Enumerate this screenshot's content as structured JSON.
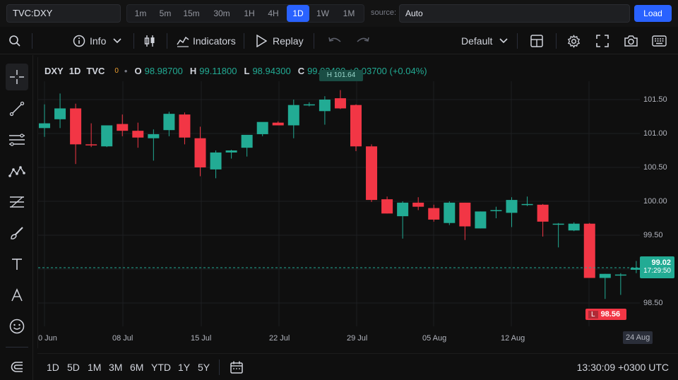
{
  "topbar": {
    "symbol": "TVC:DXY",
    "timeframes": [
      "1m",
      "5m",
      "15m",
      "30m",
      "1H",
      "4H",
      "1D",
      "1W",
      "1M"
    ],
    "active_timeframe": "1D",
    "source_label": "source:",
    "source_value": "Auto",
    "load_label": "Load"
  },
  "toolbar": {
    "info_label": "Info",
    "indicators_label": "Indicators",
    "replay_label": "Replay",
    "layout_label": "Default"
  },
  "legend": {
    "symbol": "DXY",
    "interval": "1D",
    "exchange": "TVC",
    "zero": "0",
    "open_key": "O",
    "open": "98.98700",
    "high_key": "H",
    "high": "99.11800",
    "low_key": "L",
    "low": "98.94300",
    "close_key": "C",
    "close": "99.02400",
    "change": "+0.03700 (+0.04%)"
  },
  "price_axis": {
    "labels": [
      "101.50",
      "101.00",
      "100.50",
      "100.00",
      "99.50",
      "98.50"
    ]
  },
  "time_axis": {
    "labels": [
      "0 Jun",
      "08 Jul",
      "15 Jul",
      "22 Jul",
      "29 Jul",
      "05 Aug",
      "12 Aug",
      "24 Aug"
    ]
  },
  "markers": {
    "high_marker": "H 101.64",
    "low_prefix": "L",
    "low_value": "98.56",
    "last_price": "99.02",
    "countdown": "17:29:50"
  },
  "bottom": {
    "ranges": [
      "1D",
      "5D",
      "1M",
      "3M",
      "6M",
      "YTD",
      "1Y",
      "5Y"
    ],
    "clock": "13:30:09 +0300 UTC"
  },
  "colors": {
    "up": "#22ab94",
    "down": "#f23645",
    "accent": "#2962ff"
  },
  "chart_data": {
    "type": "candlestick",
    "symbol": "DXY",
    "y_range": [
      98.4,
      101.75
    ],
    "candles": [
      {
        "o": 101.08,
        "h": 101.43,
        "l": 100.95,
        "c": 101.15
      },
      {
        "o": 101.21,
        "h": 101.59,
        "l": 101.08,
        "c": 101.37
      },
      {
        "o": 101.37,
        "h": 101.44,
        "l": 100.55,
        "c": 100.84
      },
      {
        "o": 100.84,
        "h": 101.15,
        "l": 100.8,
        "c": 100.83
      },
      {
        "o": 100.81,
        "h": 101.12,
        "l": 100.8,
        "c": 101.12
      },
      {
        "o": 101.14,
        "h": 101.28,
        "l": 100.96,
        "c": 101.04
      },
      {
        "o": 101.04,
        "h": 101.16,
        "l": 100.79,
        "c": 100.94
      },
      {
        "o": 100.93,
        "h": 101.06,
        "l": 100.6,
        "c": 100.99
      },
      {
        "o": 101.05,
        "h": 101.32,
        "l": 100.96,
        "c": 101.29
      },
      {
        "o": 101.28,
        "h": 101.31,
        "l": 100.84,
        "c": 100.94
      },
      {
        "o": 100.93,
        "h": 101.1,
        "l": 100.37,
        "c": 100.5
      },
      {
        "o": 100.47,
        "h": 100.75,
        "l": 100.34,
        "c": 100.72
      },
      {
        "o": 100.72,
        "h": 100.76,
        "l": 100.63,
        "c": 100.75
      },
      {
        "o": 100.79,
        "h": 100.97,
        "l": 100.66,
        "c": 100.98
      },
      {
        "o": 100.99,
        "h": 101.14,
        "l": 100.96,
        "c": 101.17
      },
      {
        "o": 101.16,
        "h": 101.18,
        "l": 101.12,
        "c": 101.12
      },
      {
        "o": 101.12,
        "h": 101.5,
        "l": 100.93,
        "c": 101.42
      },
      {
        "o": 101.43,
        "h": 101.46,
        "l": 101.4,
        "c": 101.43
      },
      {
        "o": 101.33,
        "h": 101.55,
        "l": 101.13,
        "c": 101.5
      },
      {
        "o": 101.52,
        "h": 101.64,
        "l": 101.36,
        "c": 101.37
      },
      {
        "o": 101.42,
        "h": 101.43,
        "l": 100.74,
        "c": 100.81
      },
      {
        "o": 100.81,
        "h": 100.84,
        "l": 99.99,
        "c": 100.02
      },
      {
        "o": 100.03,
        "h": 100.07,
        "l": 99.82,
        "c": 99.82
      },
      {
        "o": 99.78,
        "h": 100.0,
        "l": 99.45,
        "c": 99.98
      },
      {
        "o": 99.98,
        "h": 100.06,
        "l": 99.87,
        "c": 99.92
      },
      {
        "o": 99.9,
        "h": 99.95,
        "l": 99.7,
        "c": 99.73
      },
      {
        "o": 99.68,
        "h": 100.0,
        "l": 99.65,
        "c": 99.98
      },
      {
        "o": 99.98,
        "h": 99.98,
        "l": 99.43,
        "c": 99.63
      },
      {
        "o": 99.6,
        "h": 99.85,
        "l": 99.6,
        "c": 99.85
      },
      {
        "o": 99.86,
        "h": 99.92,
        "l": 99.75,
        "c": 99.87
      },
      {
        "o": 99.83,
        "h": 100.06,
        "l": 99.62,
        "c": 100.02
      },
      {
        "o": 99.96,
        "h": 100.07,
        "l": 99.93,
        "c": 99.96
      },
      {
        "o": 99.95,
        "h": 99.96,
        "l": 99.48,
        "c": 99.7
      },
      {
        "o": 99.67,
        "h": 99.68,
        "l": 99.32,
        "c": 99.67
      },
      {
        "o": 99.57,
        "h": 99.69,
        "l": 99.56,
        "c": 99.67
      },
      {
        "o": 99.67,
        "h": 99.68,
        "l": 98.9,
        "c": 98.87
      },
      {
        "o": 98.87,
        "h": 98.93,
        "l": 98.56,
        "c": 98.93
      },
      {
        "o": 98.92,
        "h": 98.94,
        "l": 98.62,
        "c": 98.92
      },
      {
        "o": 98.99,
        "h": 99.12,
        "l": 98.94,
        "c": 99.02
      }
    ]
  }
}
